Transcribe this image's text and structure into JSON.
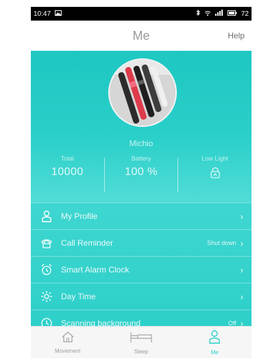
{
  "status": {
    "time": "10:47",
    "battery": "72"
  },
  "header": {
    "title": "Me",
    "help": "Help"
  },
  "profile": {
    "username": "Michio",
    "stats": [
      {
        "label": "Total",
        "value": "10000"
      },
      {
        "label": "Battery",
        "value": "100 %"
      },
      {
        "label": "Low Light",
        "value": ""
      }
    ]
  },
  "menu": [
    {
      "label": "My Profile",
      "right": "",
      "icon": "person-icon"
    },
    {
      "label": "Call Reminder",
      "right": "Shut down",
      "icon": "phone-icon"
    },
    {
      "label": "Smart Alarm Clock",
      "right": "",
      "icon": "alarm-icon"
    },
    {
      "label": "Day Time",
      "right": "",
      "icon": "sun-icon"
    },
    {
      "label": "Scanning background",
      "right": "Off",
      "icon": "scan-icon"
    }
  ],
  "tabs": [
    {
      "label": "Movement",
      "icon": "house-icon"
    },
    {
      "label": "Sleep",
      "icon": "bed-icon"
    },
    {
      "label": "Me",
      "icon": "person-icon"
    }
  ],
  "colors": {
    "accent": "#2bcfc8"
  }
}
